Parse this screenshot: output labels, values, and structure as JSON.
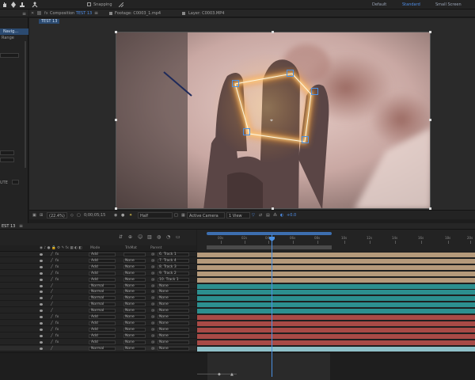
{
  "topbar": {
    "snapping_label": "Snapping",
    "workspaces": [
      "Default",
      "Standard",
      "Small Screen"
    ],
    "active_workspace": "Standard"
  },
  "viewer_tabs": {
    "composition_prefix": "Composition",
    "composition_name": "TEST 13",
    "footage_tab": "Footage: C0003_1.mp4",
    "layer_tab": "Layer: C0003.MP4",
    "comp_breadcrumb": "TEST 13"
  },
  "left_panel": {
    "label_1": "Navig...",
    "label_2": "Range",
    "label_3": "UTE"
  },
  "viewer_bar": {
    "zoom": "(22.4%)",
    "timecode": "0;00;05;15",
    "resolution": "Half",
    "camera": "Active Camera",
    "views": "1 View",
    "exposure": "+0.0"
  },
  "timeline": {
    "comp_tab": "EST 13",
    "column_headers": {
      "mode": "Mode",
      "trkmat": "TrkMat",
      "parent": "Parent"
    },
    "ruler_ticks": [
      "00s",
      "02s",
      "04s",
      "06s",
      "08s",
      "10s",
      "12s",
      "14s",
      "16s",
      "18s",
      "20s"
    ],
    "layers": [
      {
        "mode": "Add",
        "trkmat": "",
        "parent": "",
        "label": "6. Track 1",
        "color": "#b59a7b"
      },
      {
        "mode": "Add",
        "trkmat": "None",
        "parent": "",
        "label": "7. Track 4",
        "color": "#b59a7b"
      },
      {
        "mode": "Add",
        "trkmat": "None",
        "parent": "",
        "label": "8. Track 3",
        "color": "#b59a7b"
      },
      {
        "mode": "Add",
        "trkmat": "None",
        "parent": "",
        "label": "9. Track 2",
        "color": "#b59a7b"
      },
      {
        "mode": "Add",
        "trkmat": "None",
        "parent": "",
        "label": "10. Track 1",
        "color": "#b59a7b"
      },
      {
        "mode": "Normal",
        "trkmat": "None",
        "parent": "",
        "label": "None",
        "color": "#2c8f8f"
      },
      {
        "mode": "Normal",
        "trkmat": "None",
        "parent": "",
        "label": "None",
        "color": "#2c8f8f"
      },
      {
        "mode": "Normal",
        "trkmat": "None",
        "parent": "",
        "label": "None",
        "color": "#2c8f8f"
      },
      {
        "mode": "Normal",
        "trkmat": "None",
        "parent": "",
        "label": "None",
        "color": "#2c8f8f"
      },
      {
        "mode": "Normal",
        "trkmat": "None",
        "parent": "",
        "label": "None",
        "color": "#2c8f8f"
      },
      {
        "mode": "Add",
        "trkmat": "None",
        "parent": "",
        "label": "None",
        "color": "#a84a46"
      },
      {
        "mode": "Add",
        "trkmat": "None",
        "parent": "",
        "label": "None",
        "color": "#a84a46"
      },
      {
        "mode": "Add",
        "trkmat": "None",
        "parent": "",
        "label": "None",
        "color": "#a84a46"
      },
      {
        "mode": "Add",
        "trkmat": "None",
        "parent": "",
        "label": "None",
        "color": "#a84a46"
      },
      {
        "mode": "Add",
        "trkmat": "None",
        "parent": "",
        "label": "None",
        "color": "#a84a46"
      },
      {
        "mode": "Normal",
        "trkmat": "None",
        "parent": "",
        "label": "None",
        "color": "#8fc0c8"
      }
    ]
  }
}
